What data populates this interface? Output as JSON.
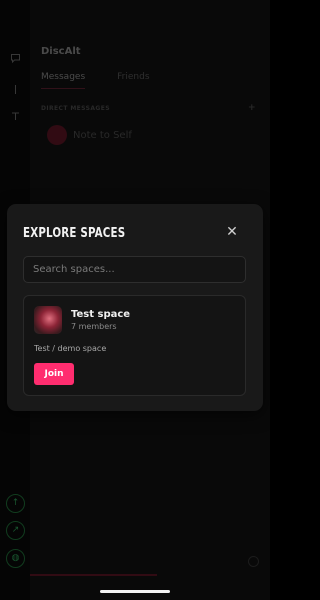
{
  "background": {
    "app_title": "DiscAlt",
    "tabs": [
      "Messages",
      "Friends"
    ],
    "section_header": "DIRECT MESSAGES",
    "add_symbol": "+",
    "dm_item": "Note to Self",
    "rail_icons": [
      "chat-bubble-icon",
      "text-cursor-icon",
      "text-tool-icon"
    ],
    "rail_bottom_icons": [
      "arrow-up-icon",
      "arrow-diagonal-icon",
      "globe-icon"
    ]
  },
  "modal": {
    "title": "EXPLORE SPACES",
    "close_symbol": "✕",
    "search_placeholder": "Search spaces...",
    "space": {
      "name": "Test space",
      "members": "7 members",
      "description": "Test / demo space",
      "join_label": "Join"
    }
  },
  "colors": {
    "accent": "#ff2d6f",
    "modal_bg": "#191919",
    "dim_overlay": "rgba(0,0,0,0.45)"
  }
}
